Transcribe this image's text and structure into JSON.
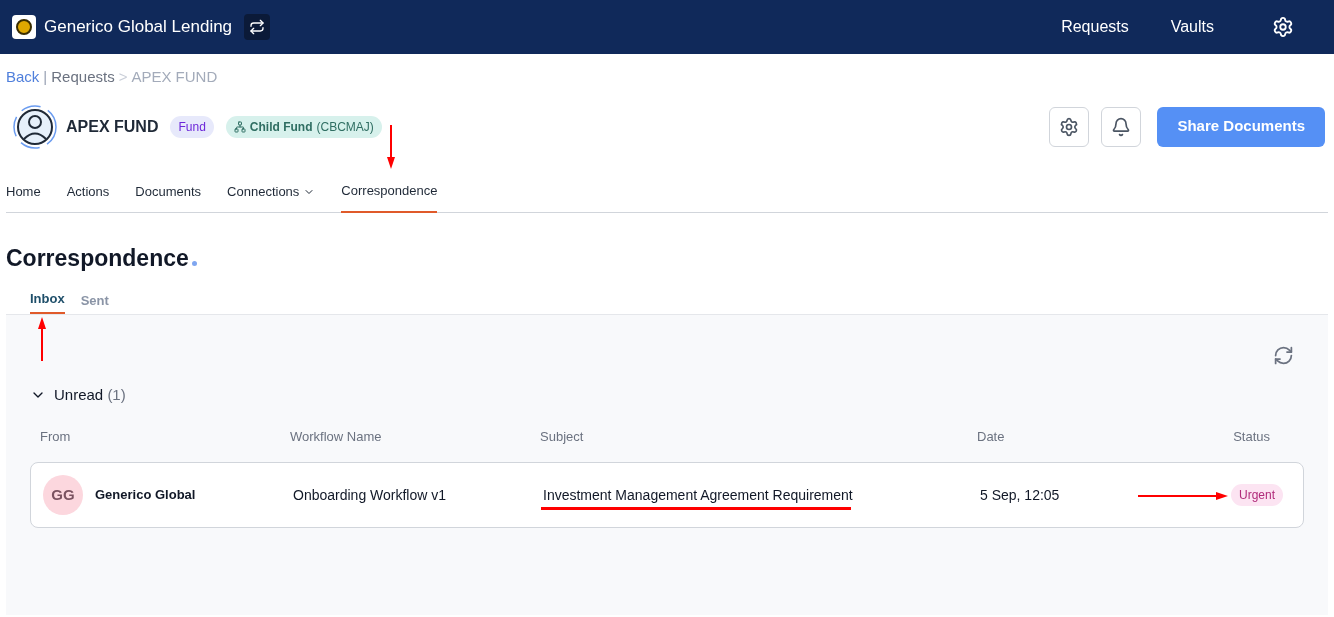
{
  "topbar": {
    "title": "Generico Global Lending",
    "links": [
      "Requests",
      "Vaults"
    ]
  },
  "breadcrumb": {
    "back": "Back",
    "separator": "|",
    "parent": "Requests",
    "arrow": ">",
    "current": "APEX FUND"
  },
  "entity": {
    "name": "APEX FUND",
    "type_badge": "Fund",
    "child_badge": {
      "label": "Child Fund",
      "code": "(CBCMAJ)"
    }
  },
  "share_button": "Share Documents",
  "nav_tabs": [
    {
      "label": "Home",
      "selected": false,
      "dropdown": false
    },
    {
      "label": "Actions",
      "selected": false,
      "dropdown": false
    },
    {
      "label": "Documents",
      "selected": false,
      "dropdown": false
    },
    {
      "label": "Connections",
      "selected": false,
      "dropdown": true
    },
    {
      "label": "Correspondence",
      "selected": true,
      "dropdown": false
    }
  ],
  "page_title": "Correspondence",
  "sub_tabs": [
    {
      "label": "Inbox",
      "selected": true
    },
    {
      "label": "Sent",
      "selected": false
    }
  ],
  "group": {
    "label": "Unread",
    "count": "(1)",
    "expanded": true
  },
  "table": {
    "columns": [
      "From",
      "Workflow Name",
      "Subject",
      "Date",
      "Status"
    ],
    "rows": [
      {
        "initials": "GG",
        "from": "Generico Global",
        "workflow": "Onboarding Workflow v1",
        "subject": "Investment Management Agreement Requirement",
        "date": "5 Sep, 12:05",
        "status": "Urgent"
      }
    ]
  }
}
